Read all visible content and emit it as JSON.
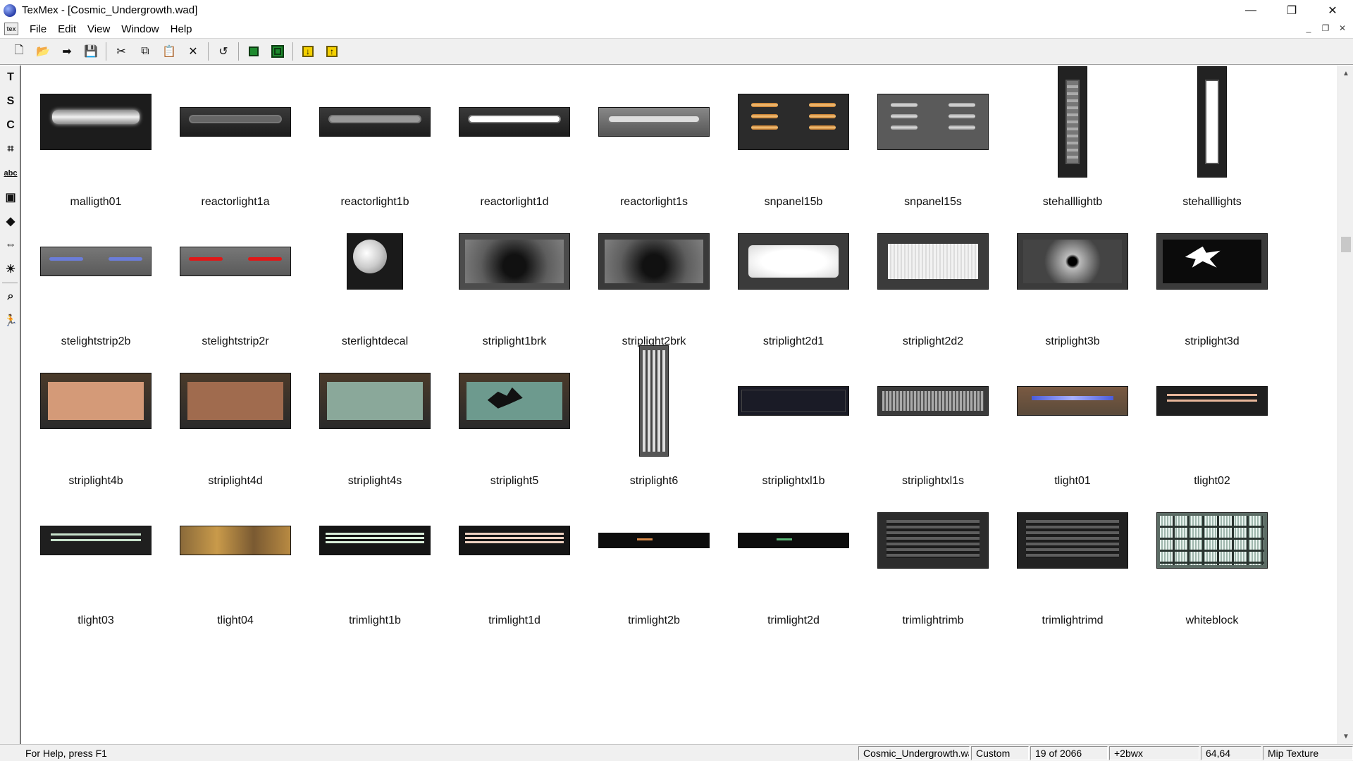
{
  "window": {
    "title": "TexMex - [Cosmic_Undergrowth.wad]",
    "controls": {
      "minimize": "—",
      "maximize": "❐",
      "close": "✕"
    }
  },
  "menu": {
    "doc_icon": "tex",
    "items": [
      "File",
      "Edit",
      "View",
      "Window",
      "Help"
    ],
    "mdi_controls": [
      "_",
      "❐",
      "✕"
    ]
  },
  "toolbar": [
    {
      "name": "new-icon",
      "glyph": "🗋"
    },
    {
      "name": "open-icon",
      "glyph": "📂"
    },
    {
      "name": "arrow-right-icon",
      "glyph": "➡"
    },
    {
      "name": "save-icon",
      "glyph": "💾"
    },
    {
      "sep": true
    },
    {
      "name": "cut-icon",
      "glyph": "✂"
    },
    {
      "name": "copy-icon",
      "glyph": "⧉"
    },
    {
      "name": "paste-icon",
      "glyph": "📋"
    },
    {
      "name": "delete-icon",
      "glyph": "✕"
    },
    {
      "sep": true
    },
    {
      "name": "undo-icon",
      "glyph": "↺"
    },
    {
      "sep": true
    },
    {
      "name": "green-square-icon",
      "kind": "green"
    },
    {
      "name": "green-square-large-icon",
      "kind": "green-lg"
    },
    {
      "sep": true
    },
    {
      "name": "yellow-import-icon",
      "kind": "yellow",
      "glyph": "↓"
    },
    {
      "name": "yellow-export-icon",
      "kind": "yellow",
      "glyph": "↑"
    }
  ],
  "tools": [
    {
      "name": "text-tool-icon",
      "glyph": "T"
    },
    {
      "name": "s-tool-icon",
      "glyph": "S"
    },
    {
      "name": "rotate-tool-icon",
      "glyph": "C"
    },
    {
      "name": "crop-tool-icon",
      "glyph": "⌗"
    },
    {
      "name": "abc-tool-icon",
      "glyph": "abc",
      "cls": "lt-abc"
    },
    {
      "name": "layer-tool-icon",
      "glyph": "▣"
    },
    {
      "name": "hue-tool-icon",
      "glyph": "◆"
    },
    {
      "name": "resize-tool-icon",
      "glyph": "⇔"
    },
    {
      "name": "brightness-tool-icon",
      "glyph": "☀"
    },
    {
      "sep": true
    },
    {
      "name": "zoom-tool-icon",
      "glyph": "⌕"
    },
    {
      "name": "run-tool-icon",
      "glyph": "🏃"
    }
  ],
  "textures": [
    {
      "label": "malligth01",
      "w": 130,
      "h": 66,
      "style": "panel-light"
    },
    {
      "label": "reactorlight1a",
      "w": 130,
      "h": 34,
      "style": "reactor-dim"
    },
    {
      "label": "reactorlight1b",
      "w": 130,
      "h": 34,
      "style": "reactor-mid"
    },
    {
      "label": "reactorlight1d",
      "w": 130,
      "h": 34,
      "style": "reactor-bright"
    },
    {
      "label": "reactorlight1s",
      "w": 130,
      "h": 34,
      "style": "reactor-silver"
    },
    {
      "label": "snpanel15b",
      "w": 130,
      "h": 66,
      "style": "snpanel-orange"
    },
    {
      "label": "snpanel15s",
      "w": 130,
      "h": 66,
      "style": "snpanel-gray"
    },
    {
      "label": "stehalllightb",
      "w": 34,
      "h": 130,
      "style": "vert-tube-dim"
    },
    {
      "label": "stehalllights",
      "w": 34,
      "h": 130,
      "style": "vert-tube-bright"
    },
    {
      "label": "stelightstrip2b",
      "w": 130,
      "h": 34,
      "style": "strip-blue"
    },
    {
      "label": "stelightstrip2r",
      "w": 130,
      "h": 34,
      "style": "strip-red"
    },
    {
      "label": "sterlightdecal",
      "w": 66,
      "h": 66,
      "style": "decal"
    },
    {
      "label": "striplight1brk",
      "w": 130,
      "h": 66,
      "style": "broken-dark"
    },
    {
      "label": "striplight2brk",
      "w": 130,
      "h": 66,
      "style": "broken-darker"
    },
    {
      "label": "striplight2d1",
      "w": 130,
      "h": 66,
      "style": "white-glow"
    },
    {
      "label": "striplight2d2",
      "w": 130,
      "h": 66,
      "style": "white-grid"
    },
    {
      "label": "striplight3b",
      "w": 130,
      "h": 66,
      "style": "shatter-dark"
    },
    {
      "label": "striplight3d",
      "w": 130,
      "h": 66,
      "style": "shatter-white"
    },
    {
      "label": "striplight4b",
      "w": 130,
      "h": 66,
      "style": "peach"
    },
    {
      "label": "striplight4d",
      "w": 130,
      "h": 66,
      "style": "rust"
    },
    {
      "label": "striplight4s",
      "w": 130,
      "h": 66,
      "style": "teal"
    },
    {
      "label": "striplight5",
      "w": 130,
      "h": 66,
      "style": "teal-broken"
    },
    {
      "label": "striplight6",
      "w": 34,
      "h": 130,
      "style": "vert-tubes"
    },
    {
      "label": "striplightxl1b",
      "w": 130,
      "h": 34,
      "style": "navy"
    },
    {
      "label": "striplightxl1s",
      "w": 130,
      "h": 34,
      "style": "grill"
    },
    {
      "label": "tlight01",
      "w": 130,
      "h": 34,
      "style": "rust-blue"
    },
    {
      "label": "tlight02",
      "w": 130,
      "h": 34,
      "style": "dark-peach"
    },
    {
      "label": "tlight03",
      "w": 130,
      "h": 34,
      "style": "dark-mint"
    },
    {
      "label": "tlight04",
      "w": 130,
      "h": 34,
      "style": "brown-gold"
    },
    {
      "label": "trimlight1b",
      "w": 130,
      "h": 34,
      "style": "trim-mint"
    },
    {
      "label": "trimlight1d",
      "w": 130,
      "h": 34,
      "style": "trim-peach"
    },
    {
      "label": "trimlight2b",
      "w": 130,
      "h": 18,
      "style": "slit-orange"
    },
    {
      "label": "trimlight2d",
      "w": 130,
      "h": 18,
      "style": "slit-green"
    },
    {
      "label": "trimlightrimb",
      "w": 130,
      "h": 66,
      "style": "louver"
    },
    {
      "label": "trimlightrimd",
      "w": 130,
      "h": 66,
      "style": "louver-dark"
    },
    {
      "label": "whiteblock",
      "w": 130,
      "h": 66,
      "style": "whiteblock"
    }
  ],
  "status": {
    "help": "For Help, press F1",
    "panes": [
      "Cosmic_Undergrowth.wad",
      "Custom",
      "19 of 2066",
      "+2bwx",
      "64,64",
      "Mip Texture"
    ]
  }
}
